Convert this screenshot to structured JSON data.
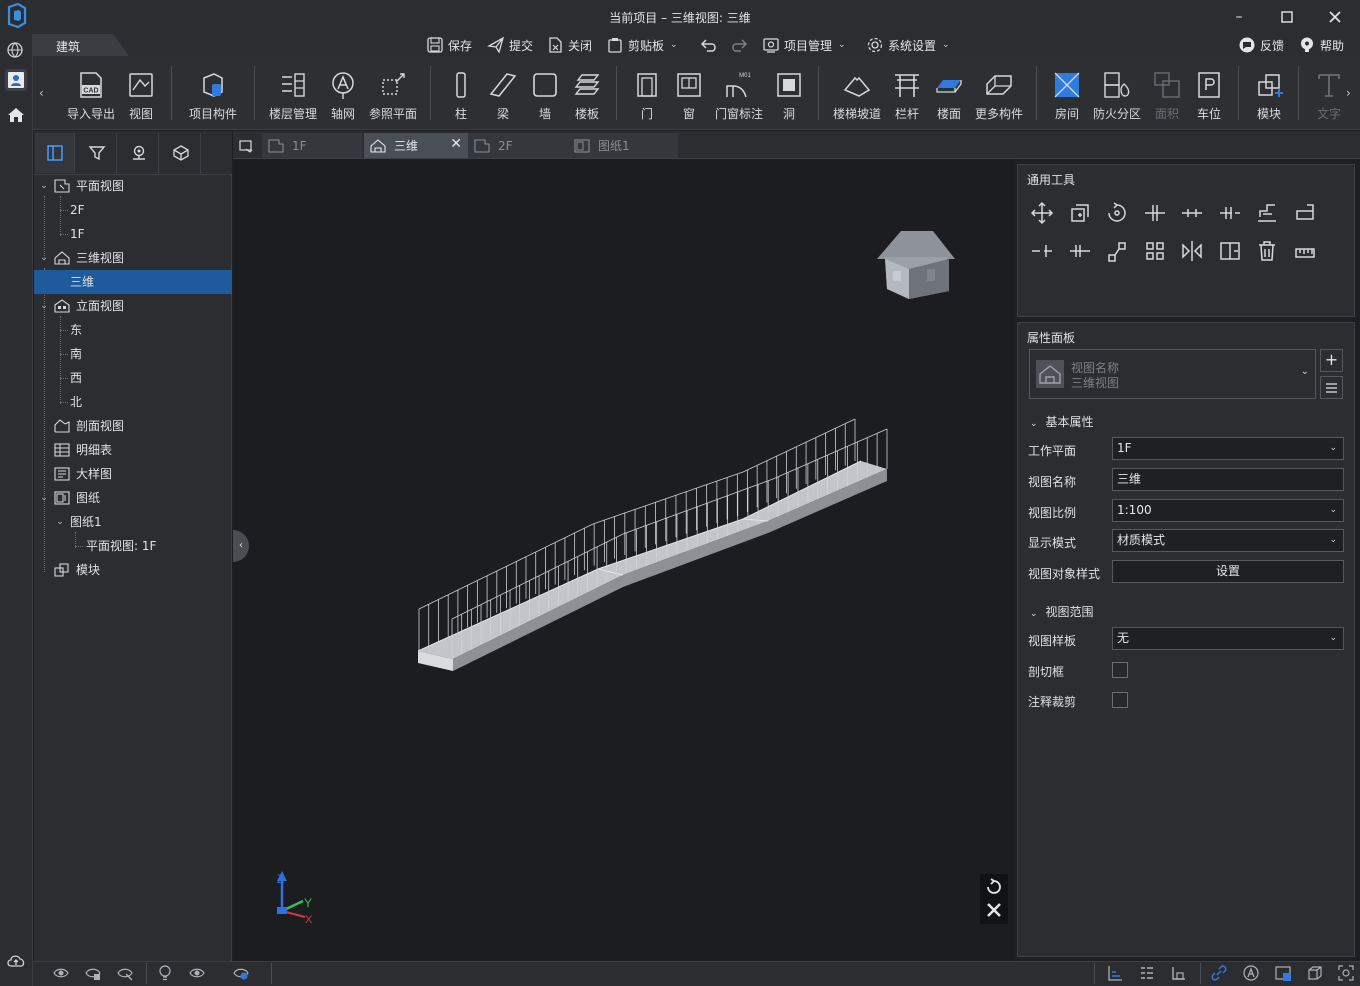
{
  "window": {
    "title": "当前项目 – 三维视图: 三维",
    "minimize_icon": "minimize-icon",
    "maximize_icon": "maximize-icon",
    "close_icon": "close-icon"
  },
  "appstrip": {
    "icons": [
      "globe-settings-icon",
      "user-card-icon",
      "home-icon",
      "cloud-upload-icon"
    ]
  },
  "header": {
    "tab": "建筑",
    "save": "保存",
    "submit": "提交",
    "close": "关闭",
    "clipboard": "剪贴板",
    "project_mgmt": "项目管理",
    "system_settings": "系统设置",
    "feedback": "反馈",
    "help": "帮助"
  },
  "ribbon": {
    "import_export": "导入导出",
    "view": "视图",
    "project_component": "项目构件",
    "floor_mgmt": "楼层管理",
    "axis_grid": "轴网",
    "ref_plane": "参照平面",
    "column": "柱",
    "beam": "梁",
    "wall": "墙",
    "slab": "楼板",
    "door": "门",
    "window": "窗",
    "door_window_tag": "门窗标注",
    "opening": "洞",
    "stairs_ramp": "楼梯坡道",
    "railing": "栏杆",
    "floor_surface": "楼面",
    "more_components": "更多构件",
    "room": "房间",
    "fire_zone": "防火分区",
    "area": "面积",
    "parking": "车位",
    "module": "模块",
    "text": "文字",
    "cad_badge": "CAD",
    "door_tag_badge": "M01"
  },
  "tree": {
    "plan_views": "平面视图",
    "plan_2f": "2F",
    "plan_1f": "1F",
    "views_3d": "三维视图",
    "view_3d": "三维",
    "elevation_views": "立面视图",
    "east": "东",
    "south": "南",
    "west": "西",
    "north": "北",
    "section_views": "剖面视图",
    "schedule": "明细表",
    "detail_view": "大样图",
    "drawings": "图纸",
    "drawing1": "图纸1",
    "drawing1_plan": "平面视图: 1F",
    "modules": "模块"
  },
  "doc_tabs": {
    "tab_1f": "1F",
    "tab_3d": "三维",
    "tab_2f": "2F",
    "tab_drawing1": "图纸1"
  },
  "viewport": {
    "axis_x": "X",
    "axis_y": "Y",
    "axis_z": "Z"
  },
  "tools_panel": {
    "title": "通用工具",
    "icons": [
      "move-icon",
      "copy-icon",
      "rotate-icon",
      "split-icon",
      "align-icon",
      "offset-icon",
      "extend-icon",
      "trim-icon",
      "trim-left-icon",
      "trim-right-icon",
      "array-linear-icon",
      "array-grid-icon",
      "mirror-icon",
      "mirror-copy-icon",
      "delete-icon",
      "measure-icon"
    ]
  },
  "prop_panel": {
    "title": "属性面板",
    "type_name": "视图名称",
    "type_sub": "三维视图",
    "basic_section": "基本属性",
    "work_plane_label": "工作平面",
    "work_plane_value": "1F",
    "view_name_label": "视图名称",
    "view_name_value": "三维",
    "scale_label": "视图比例",
    "scale_value": "1:100",
    "display_mode_label": "显示模式",
    "display_mode_value": "材质模式",
    "object_style_label": "视图对象样式",
    "object_style_button": "设置",
    "range_section": "视图范围",
    "template_label": "视图样板",
    "template_value": "无",
    "section_box_label": "剖切框",
    "section_box_checked": false,
    "annotation_crop_label": "注释裁剪",
    "annotation_crop_checked": false
  },
  "colors": {
    "accent": "#1e5a9c",
    "viewport_bg": "#1c1d21",
    "panel_bg": "#2b2d31",
    "axis_x": "#d43a3a",
    "axis_y": "#3cbf4a",
    "axis_z": "#2f6fe0"
  }
}
